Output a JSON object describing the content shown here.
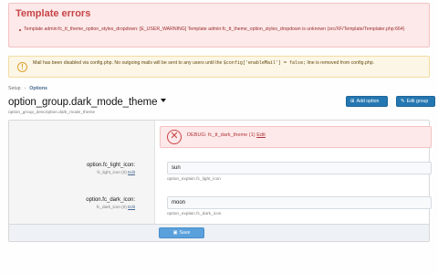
{
  "template_errors": {
    "title": "Template errors",
    "items": [
      "Template admin:fc_tt_theme_option_styles_dropdown: [E_USER_WARNING] Template admin:fc_tt_theme_option_styles_dropdown is unknown (src/XF/Template/Templater.php:664)"
    ]
  },
  "mail_warning": {
    "icon": "exclamation-icon",
    "text_before": "Mail has been disabled via config.php. No outgoing mails will be sent to any users until the ",
    "code": "$config['enableMail'] = false;",
    "text_after": " line is removed from config.php."
  },
  "breadcrumb": {
    "items": [
      "Setup",
      "Options"
    ],
    "separator": "›"
  },
  "header": {
    "title": "option_group.dark_mode_theme",
    "description": "option_group_description.dark_mode_theme",
    "add_option_label": "Add option",
    "edit_group_label": "Edit group"
  },
  "debug": {
    "text": "DEBUG: fc_tt_dark_theme (1)",
    "edit_label": "Edit"
  },
  "fields": [
    {
      "label": "option.fc_light_icon:",
      "sub": "fc_light_icon (0)",
      "sub_edit": "Edit",
      "value": "sun",
      "explain": "option_explain.fc_light_icon"
    },
    {
      "label": "option.fc_dark_icon:",
      "sub": "fc_dark_icon (0)",
      "sub_edit": "Edit",
      "value": "moon",
      "explain": "option_explain.fc_dark_icon"
    }
  ],
  "footer": {
    "save_label": "Save"
  },
  "colors": {
    "error_title": "#c84448",
    "primary_button": "#2577b1",
    "save_button": "#5aa0dc",
    "warning_border": "#f2dca1"
  }
}
